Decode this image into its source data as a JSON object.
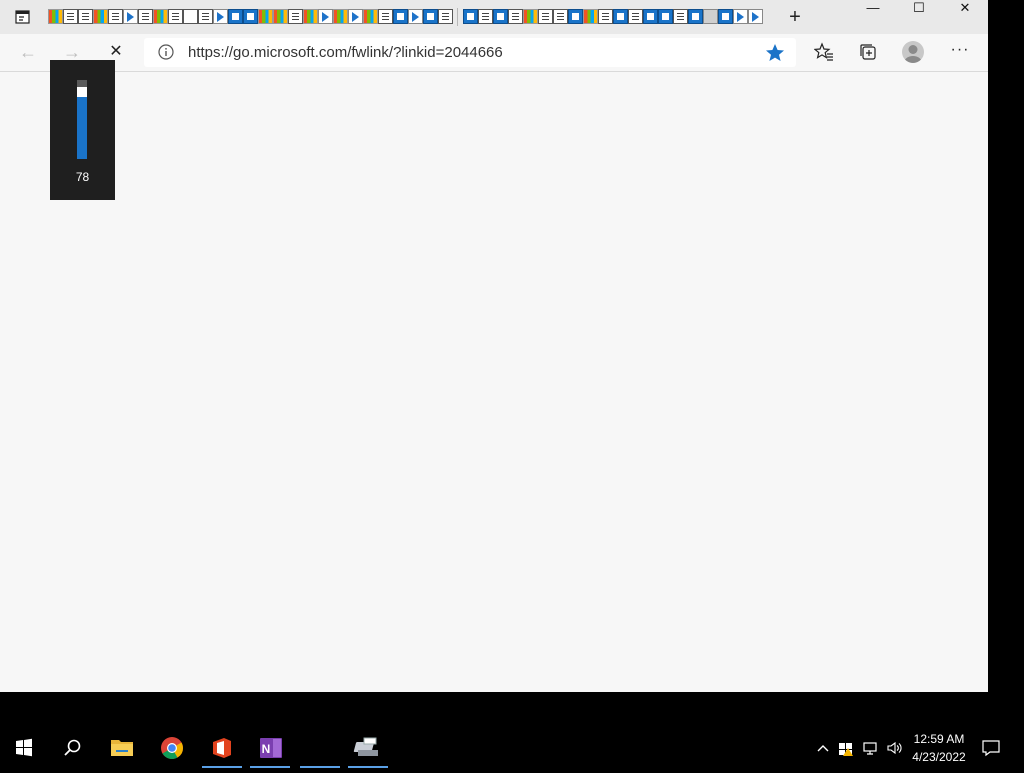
{
  "tabstrip": {
    "tab_icons": [
      "ms",
      "doc",
      "doc",
      "ms",
      "doc",
      "vs",
      "doc",
      "ms",
      "doc",
      "cursor",
      "doc",
      "vs",
      "store",
      "store",
      "ms",
      "ms",
      "doc",
      "ms",
      "vs",
      "ms",
      "vs",
      "ms",
      "doc",
      "store",
      "vs",
      "store",
      "doc",
      "sep",
      "store",
      "doc",
      "store",
      "doc",
      "ms",
      "doc",
      "doc",
      "store",
      "ms",
      "doc",
      "store",
      "doc",
      "store",
      "store",
      "doc",
      "store",
      "gray",
      "store",
      "vs",
      "vs"
    ],
    "new_tab_label": "+",
    "window_controls": {
      "minimize": "—",
      "maximize": "☐",
      "close": "✕"
    }
  },
  "toolbar": {
    "back_label": "←",
    "forward_label": "→",
    "stop_label": "✕",
    "url": "https://go.microsoft.com/fwlink/?linkid=2044666",
    "favorite_active_color": "#1a73c8",
    "more_label": "···"
  },
  "volume": {
    "level": 78,
    "label": "78"
  },
  "taskbar": {
    "apps": [
      {
        "name": "file-explorer",
        "running": false
      },
      {
        "name": "chrome",
        "running": false
      },
      {
        "name": "office",
        "running": true
      },
      {
        "name": "onenote",
        "running": true
      },
      {
        "name": "blank-app",
        "running": true
      },
      {
        "name": "printer-app",
        "running": true
      }
    ],
    "clock": {
      "time": "12:59 AM",
      "date": "4/23/2022"
    }
  },
  "colors": {
    "accent": "#1a73c8",
    "taskbar_bg": "#000000",
    "browser_bg": "#f7f7f7"
  }
}
